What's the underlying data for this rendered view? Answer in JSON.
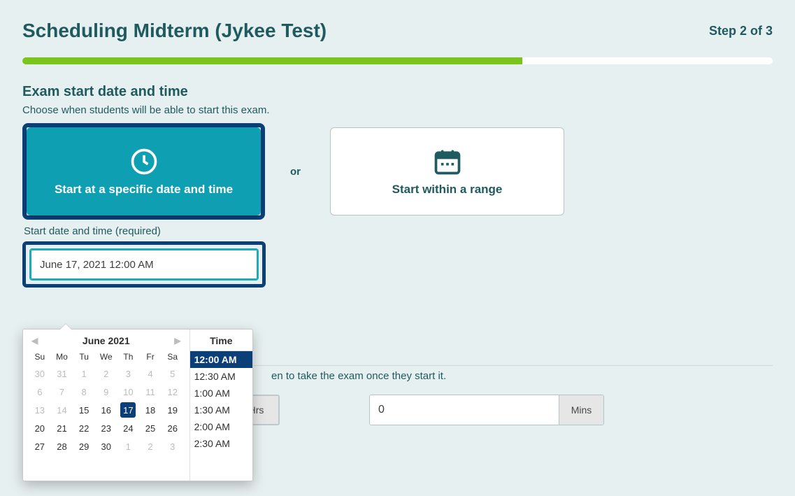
{
  "header": {
    "title": "Scheduling Midterm (Jykee Test)",
    "step": "Step 2 of 3"
  },
  "progress_percent": 66.66,
  "section": {
    "title": "Exam start date and time",
    "sub": "Choose when students will be able to start this exam."
  },
  "cards": {
    "specific": "Start at a specific date and time",
    "or": "or",
    "range": "Start within a range"
  },
  "datetime": {
    "label": "Start date and time (required)",
    "value": "June 17, 2021 12:00 AM"
  },
  "calendar": {
    "month": "June 2021",
    "dow": [
      "Su",
      "Mo",
      "Tu",
      "We",
      "Th",
      "Fr",
      "Sa"
    ],
    "rows": [
      [
        {
          "d": 30,
          "muted": true
        },
        {
          "d": 31,
          "muted": true
        },
        {
          "d": 1,
          "muted": true
        },
        {
          "d": 2,
          "muted": true
        },
        {
          "d": 3,
          "muted": true
        },
        {
          "d": 4,
          "muted": true
        },
        {
          "d": 5,
          "muted": true
        }
      ],
      [
        {
          "d": 6,
          "muted": true
        },
        {
          "d": 7,
          "muted": true
        },
        {
          "d": 8,
          "muted": true
        },
        {
          "d": 9,
          "muted": true
        },
        {
          "d": 10,
          "muted": true
        },
        {
          "d": 11,
          "muted": true
        },
        {
          "d": 12,
          "muted": true
        }
      ],
      [
        {
          "d": 13,
          "muted": true
        },
        {
          "d": 14,
          "muted": true
        },
        {
          "d": 15
        },
        {
          "d": 16
        },
        {
          "d": 17,
          "sel": true
        },
        {
          "d": 18
        },
        {
          "d": 19
        }
      ],
      [
        {
          "d": 20
        },
        {
          "d": 21
        },
        {
          "d": 22
        },
        {
          "d": 23
        },
        {
          "d": 24
        },
        {
          "d": 25
        },
        {
          "d": 26
        }
      ],
      [
        {
          "d": 27
        },
        {
          "d": 28
        },
        {
          "d": 29
        },
        {
          "d": 30
        },
        {
          "d": 1,
          "muted": true
        },
        {
          "d": 2,
          "muted": true
        },
        {
          "d": 3,
          "muted": true
        }
      ]
    ],
    "time_header": "Time",
    "times": [
      {
        "label": "12:00 AM",
        "sel": true
      },
      {
        "label": "12:30 AM"
      },
      {
        "label": "1:00 AM"
      },
      {
        "label": "1:30 AM"
      },
      {
        "label": "2:00 AM"
      },
      {
        "label": "2:30 AM"
      }
    ]
  },
  "duration": {
    "text_tail": "en to take the exam once they start it.",
    "hours_value": "",
    "mins_value": "0",
    "hours_unit": "Hrs",
    "mins_unit": "Mins"
  }
}
